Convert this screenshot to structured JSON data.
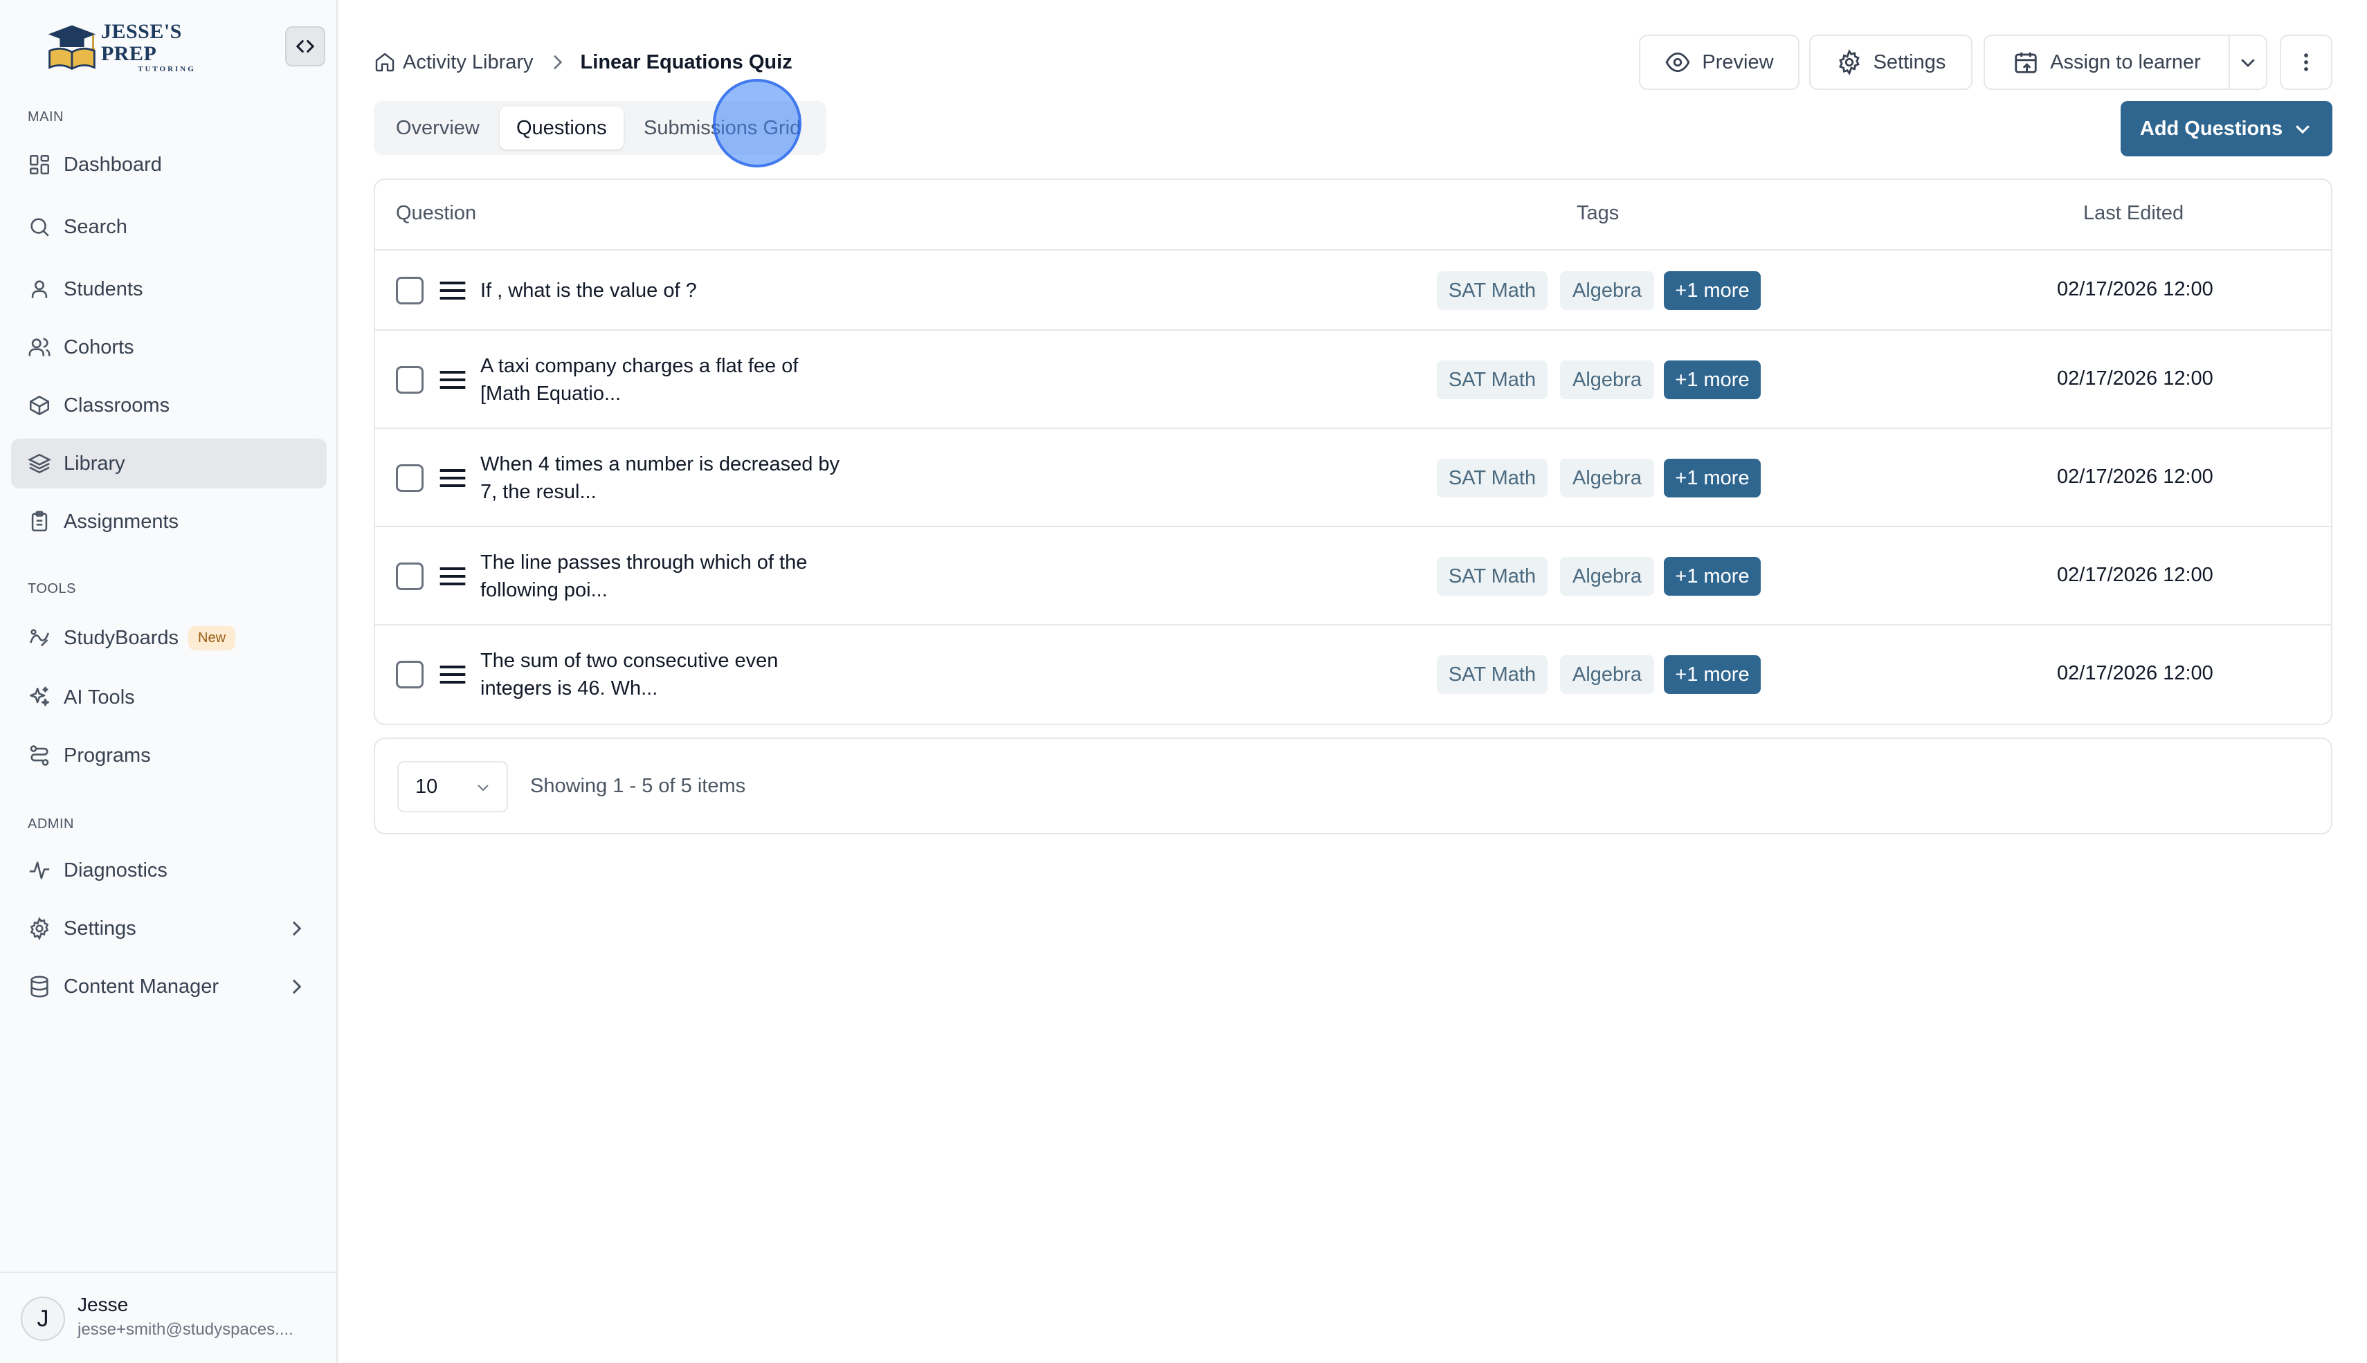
{
  "brand": {
    "name": "JESSE'S PREP",
    "sub": "TUTORING",
    "primary": "#2f6690"
  },
  "sidebar": {
    "sections": {
      "main": "MAIN",
      "tools": "TOOLS",
      "admin": "ADMIN"
    },
    "items": [
      {
        "label": "Dashboard",
        "icon": "dashboard-icon"
      },
      {
        "label": "Search",
        "icon": "search-icon"
      },
      {
        "label": "Students",
        "icon": "user-icon"
      },
      {
        "label": "Cohorts",
        "icon": "users-icon"
      },
      {
        "label": "Classrooms",
        "icon": "box-icon"
      },
      {
        "label": "Library",
        "icon": "layers-icon",
        "active": true
      },
      {
        "label": "Assignments",
        "icon": "clipboard-icon"
      },
      {
        "label": "StudyBoards",
        "icon": "studyboards-icon",
        "badge": "New"
      },
      {
        "label": "AI Tools",
        "icon": "sparkle-icon"
      },
      {
        "label": "Programs",
        "icon": "route-icon"
      },
      {
        "label": "Diagnostics",
        "icon": "activity-icon"
      },
      {
        "label": "Settings",
        "icon": "gear-icon"
      },
      {
        "label": "Content Manager",
        "icon": "database-icon"
      }
    ]
  },
  "user": {
    "initial": "J",
    "name": "Jesse",
    "email": "jesse+smith@studyspaces...."
  },
  "breadcrumb": {
    "parent": "Activity Library",
    "current": "Linear Equations Quiz"
  },
  "toolbar": {
    "preview": "Preview",
    "settings": "Settings",
    "assign": "Assign to learner",
    "add_questions": "Add Questions"
  },
  "tabs": [
    "Overview",
    "Questions",
    "Submissions Grid"
  ],
  "table": {
    "headers": {
      "question": "Question",
      "tags": "Tags",
      "last_edited": "Last Edited"
    },
    "rows": [
      {
        "line1": "If , what is the value of ?",
        "line2": "",
        "tags": [
          "SAT Math",
          "Algebra"
        ],
        "more": "+1 more",
        "date": "02/17/2026 12:00"
      },
      {
        "line1": "A taxi company charges a flat fee of",
        "line2": "[Math Equatio...",
        "tags": [
          "SAT Math",
          "Algebra"
        ],
        "more": "+1 more",
        "date": "02/17/2026 12:00"
      },
      {
        "line1": "When 4 times a number is decreased by",
        "line2": "7, the resul...",
        "tags": [
          "SAT Math",
          "Algebra"
        ],
        "more": "+1 more",
        "date": "02/17/2026 12:00"
      },
      {
        "line1": "The line passes through which of the",
        "line2": "following poi...",
        "tags": [
          "SAT Math",
          "Algebra"
        ],
        "more": "+1 more",
        "date": "02/17/2026 12:00"
      },
      {
        "line1": "The sum of two consecutive even",
        "line2": "integers is 46. Wh...",
        "tags": [
          "SAT Math",
          "Algebra"
        ],
        "more": "+1 more",
        "date": "02/17/2026 12:00"
      }
    ]
  },
  "pager": {
    "page_size": "10",
    "info": "Showing 1 - 5 of 5 items"
  }
}
